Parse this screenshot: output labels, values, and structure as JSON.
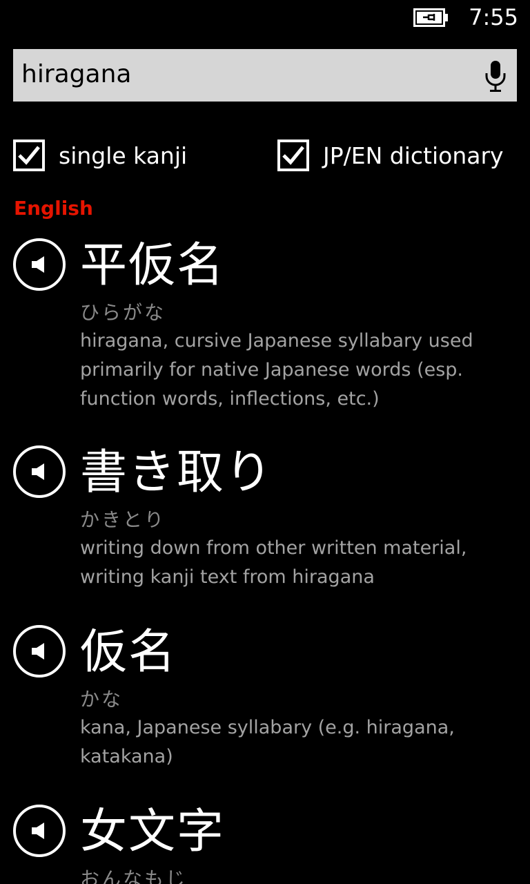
{
  "status_bar": {
    "time": "7:55",
    "battery_icon": "battery-charging-icon"
  },
  "search": {
    "value": "hiragana",
    "mic_icon": "microphone-icon"
  },
  "options": {
    "single_kanji": {
      "label": "single kanji",
      "checked": true
    },
    "jp_en_dictionary": {
      "label": "JP/EN dictionary",
      "checked": true
    }
  },
  "section": {
    "title": "English",
    "color": "#e51400"
  },
  "entries": [
    {
      "word": "平仮名",
      "reading": "ひらがな",
      "meaning": "hiragana, cursive Japanese syllabary used primarily for native Japanese words (esp. function words, inflections, etc.)"
    },
    {
      "word": "書き取り",
      "reading": "かきとり",
      "meaning": "writing down from other written material, writing kanji text from hiragana"
    },
    {
      "word": "仮名",
      "reading": "かな",
      "meaning": "kana, Japanese syllabary (e.g. hiragana, katakana)"
    },
    {
      "word": "女文字",
      "reading": "おんなもじ",
      "meaning": ""
    }
  ]
}
